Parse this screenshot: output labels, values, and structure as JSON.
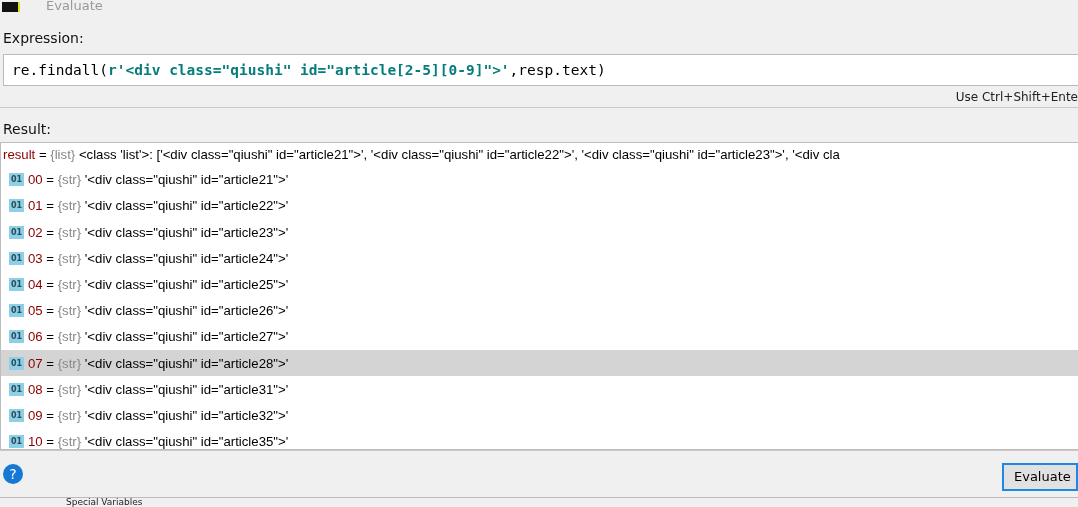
{
  "window": {
    "title": "Evaluate"
  },
  "expression": {
    "label": "Expression:",
    "segments": [
      {
        "kind": "code",
        "text": "re.findall("
      },
      {
        "kind": "string",
        "text": "r'<div class=\"qiushi\" id=\"article[2-5][0-9]\">'"
      },
      {
        "kind": "code",
        "text": ",resp.text)"
      }
    ],
    "hint": "Use Ctrl+Shift+Ente"
  },
  "result": {
    "label": "Result:",
    "separator": "=",
    "root": {
      "name": "result",
      "type": "{list}",
      "value": "<class 'list'>: ['<div class=\"qiushi\" id=\"article21\">', '<div class=\"qiushi\" id=\"article22\">', '<div class=\"qiushi\" id=\"article23\">', '<div cla"
    },
    "rows": [
      {
        "badge": "01",
        "name": "00",
        "type": "{str}",
        "value": "'<div class=\"qiushi\" id=\"article21\">'",
        "selected": false
      },
      {
        "badge": "01",
        "name": "01",
        "type": "{str}",
        "value": "'<div class=\"qiushi\" id=\"article22\">'",
        "selected": false
      },
      {
        "badge": "01",
        "name": "02",
        "type": "{str}",
        "value": "'<div class=\"qiushi\" id=\"article23\">'",
        "selected": false
      },
      {
        "badge": "01",
        "name": "03",
        "type": "{str}",
        "value": "'<div class=\"qiushi\" id=\"article24\">'",
        "selected": false
      },
      {
        "badge": "01",
        "name": "04",
        "type": "{str}",
        "value": "'<div class=\"qiushi\" id=\"article25\">'",
        "selected": false
      },
      {
        "badge": "01",
        "name": "05",
        "type": "{str}",
        "value": "'<div class=\"qiushi\" id=\"article26\">'",
        "selected": false
      },
      {
        "badge": "01",
        "name": "06",
        "type": "{str}",
        "value": "'<div class=\"qiushi\" id=\"article27\">'",
        "selected": false
      },
      {
        "badge": "01",
        "name": "07",
        "type": "{str}",
        "value": "'<div class=\"qiushi\" id=\"article28\">'",
        "selected": true
      },
      {
        "badge": "01",
        "name": "08",
        "type": "{str}",
        "value": "'<div class=\"qiushi\" id=\"article31\">'",
        "selected": false
      },
      {
        "badge": "01",
        "name": "09",
        "type": "{str}",
        "value": "'<div class=\"qiushi\" id=\"article32\">'",
        "selected": false
      },
      {
        "badge": "01",
        "name": "10",
        "type": "{str}",
        "value": "'<div class=\"qiushi\" id=\"article35\">'",
        "selected": false
      }
    ]
  },
  "help": "?",
  "buttons": [
    {
      "label": "Evaluate"
    }
  ],
  "background_panel": {
    "label": "Special Variables"
  }
}
